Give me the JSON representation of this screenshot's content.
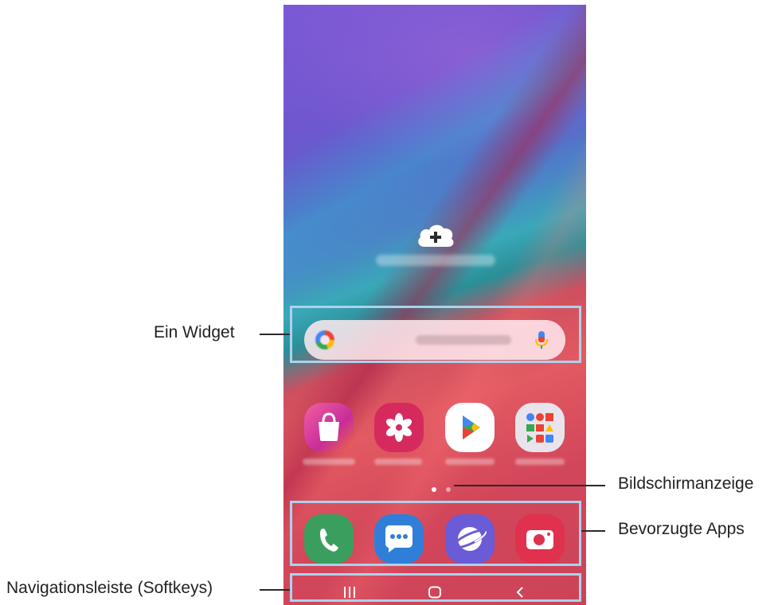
{
  "labels": {
    "widget": "Ein Widget",
    "page_indicator": "Bildschirmanzeige",
    "favorite_apps": "Bevorzugte Apps",
    "nav_bar": "Navigationsleiste (Softkeys)"
  },
  "home": {
    "empty_widget_icon": "cloud-plus-icon",
    "search": {
      "logo": "google-g-icon",
      "mic": "microphone-icon"
    },
    "apps_row": [
      {
        "icon": "galaxy-store-icon",
        "color": "#e2407f"
      },
      {
        "icon": "gallery-icon",
        "color": "#d62a5e"
      },
      {
        "icon": "play-store-icon",
        "color": "#ffffff"
      },
      {
        "icon": "google-folder-icon",
        "color": "#e9e4ec"
      }
    ],
    "page_indicator": {
      "count": 2,
      "active_index": 0
    },
    "dock": [
      {
        "icon": "phone-icon",
        "color": "#3a9f5e"
      },
      {
        "icon": "messages-icon",
        "color": "#2f7fd8"
      },
      {
        "icon": "internet-icon",
        "color": "#6a5bd6"
      },
      {
        "icon": "camera-icon",
        "color": "#e0314e"
      }
    ],
    "nav": {
      "recents": "recents-icon",
      "home": "home-icon",
      "back": "back-icon"
    }
  },
  "colors": {
    "highlight_border": "#a9d3ec",
    "callout_line": "#2a2a2a"
  }
}
